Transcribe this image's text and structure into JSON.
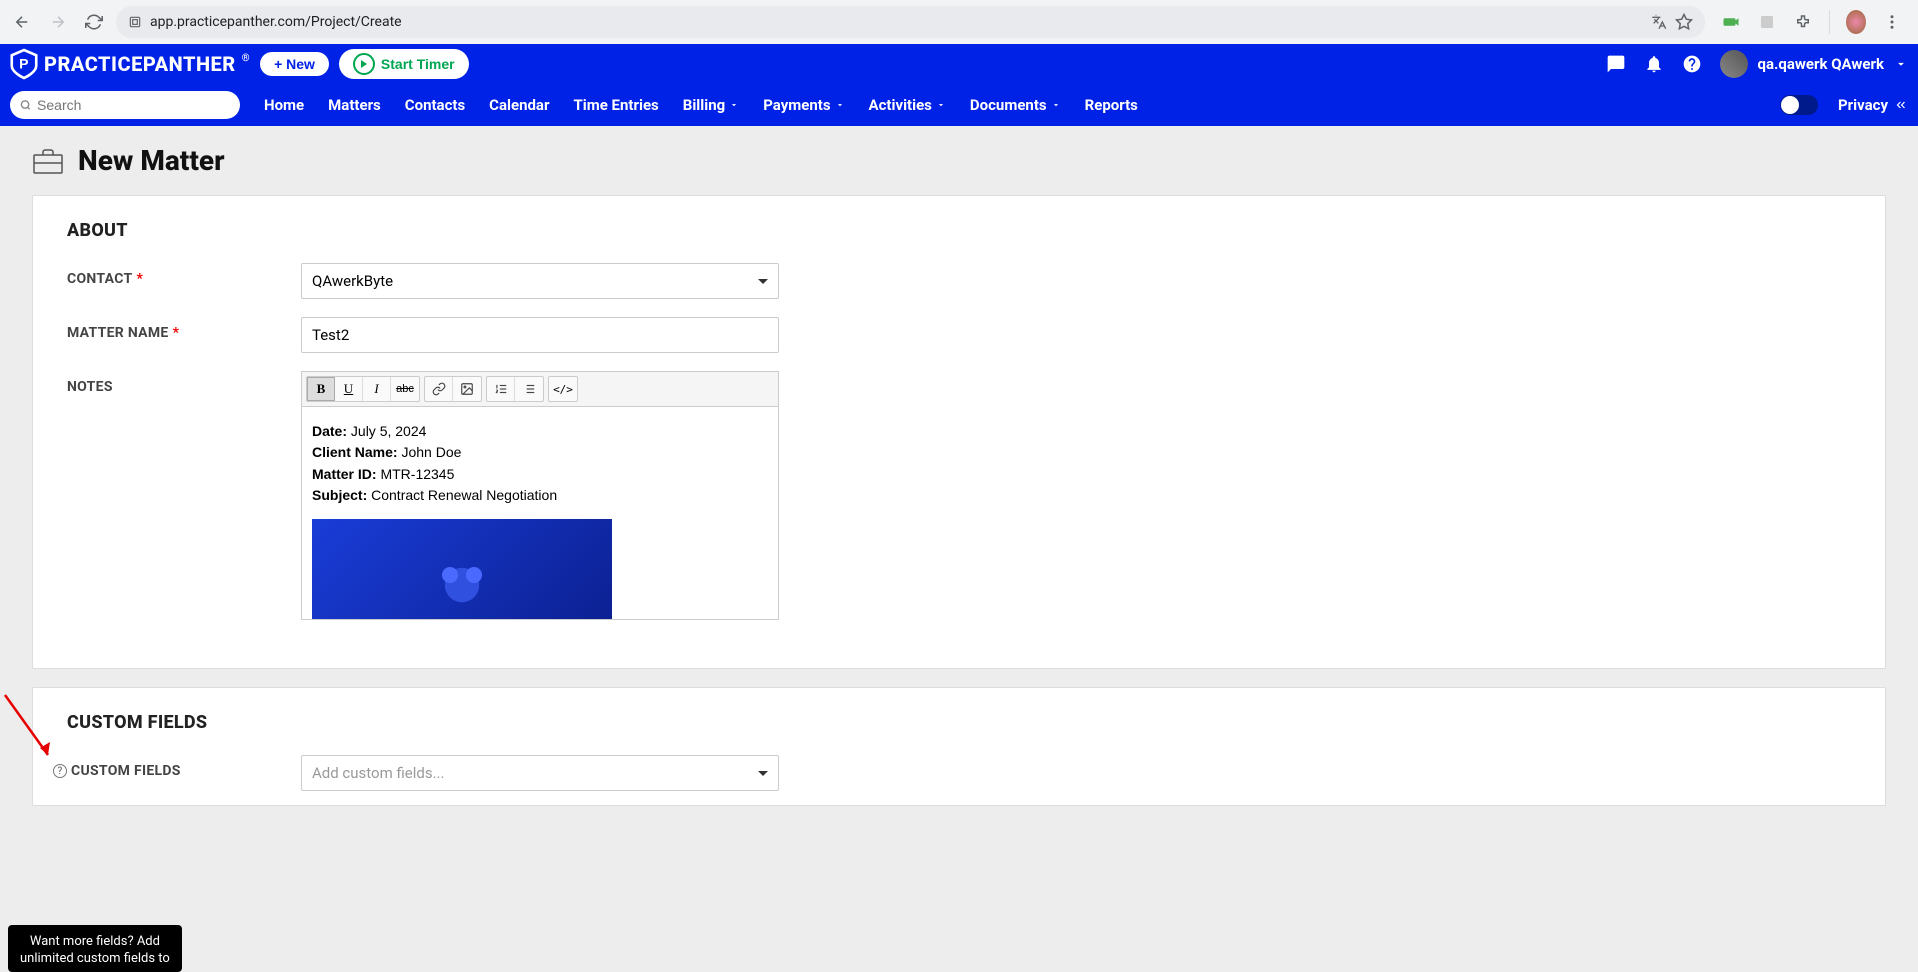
{
  "browser": {
    "url": "app.practicepanther.com/Project/Create"
  },
  "top": {
    "brand": "PRACTICEPANTHER",
    "new_btn": "+ New",
    "timer_btn": "Start Timer",
    "user_name": "qa.qawerk QAwerk"
  },
  "nav": {
    "search_placeholder": "Search",
    "items": [
      "Home",
      "Matters",
      "Contacts",
      "Calendar",
      "Time Entries",
      "Billing",
      "Payments",
      "Activities",
      "Documents",
      "Reports"
    ],
    "privacy": "Privacy"
  },
  "page": {
    "title": "New Matter"
  },
  "about": {
    "heading": "ABOUT",
    "contact_label": "CONTACT",
    "contact_value": "QAwerkByte",
    "matter_label": "MATTER NAME",
    "matter_value": "Test2",
    "notes_label": "NOTES",
    "notes": {
      "date_k": "Date:",
      "date_v": "July 5, 2024",
      "client_k": "Client Name:",
      "client_v": "John Doe",
      "matter_k": "Matter ID:",
      "matter_v": "MTR-12345",
      "subject_k": "Subject:",
      "subject_v": "Contract Renewal Negotiation"
    }
  },
  "custom": {
    "heading": "CUSTOM FIELDS",
    "field_label": "CUSTOM FIELDS",
    "placeholder": "Add custom fields...",
    "tooltip_l1": "Want more fields? Add",
    "tooltip_l2": "unlimited custom fields to"
  }
}
